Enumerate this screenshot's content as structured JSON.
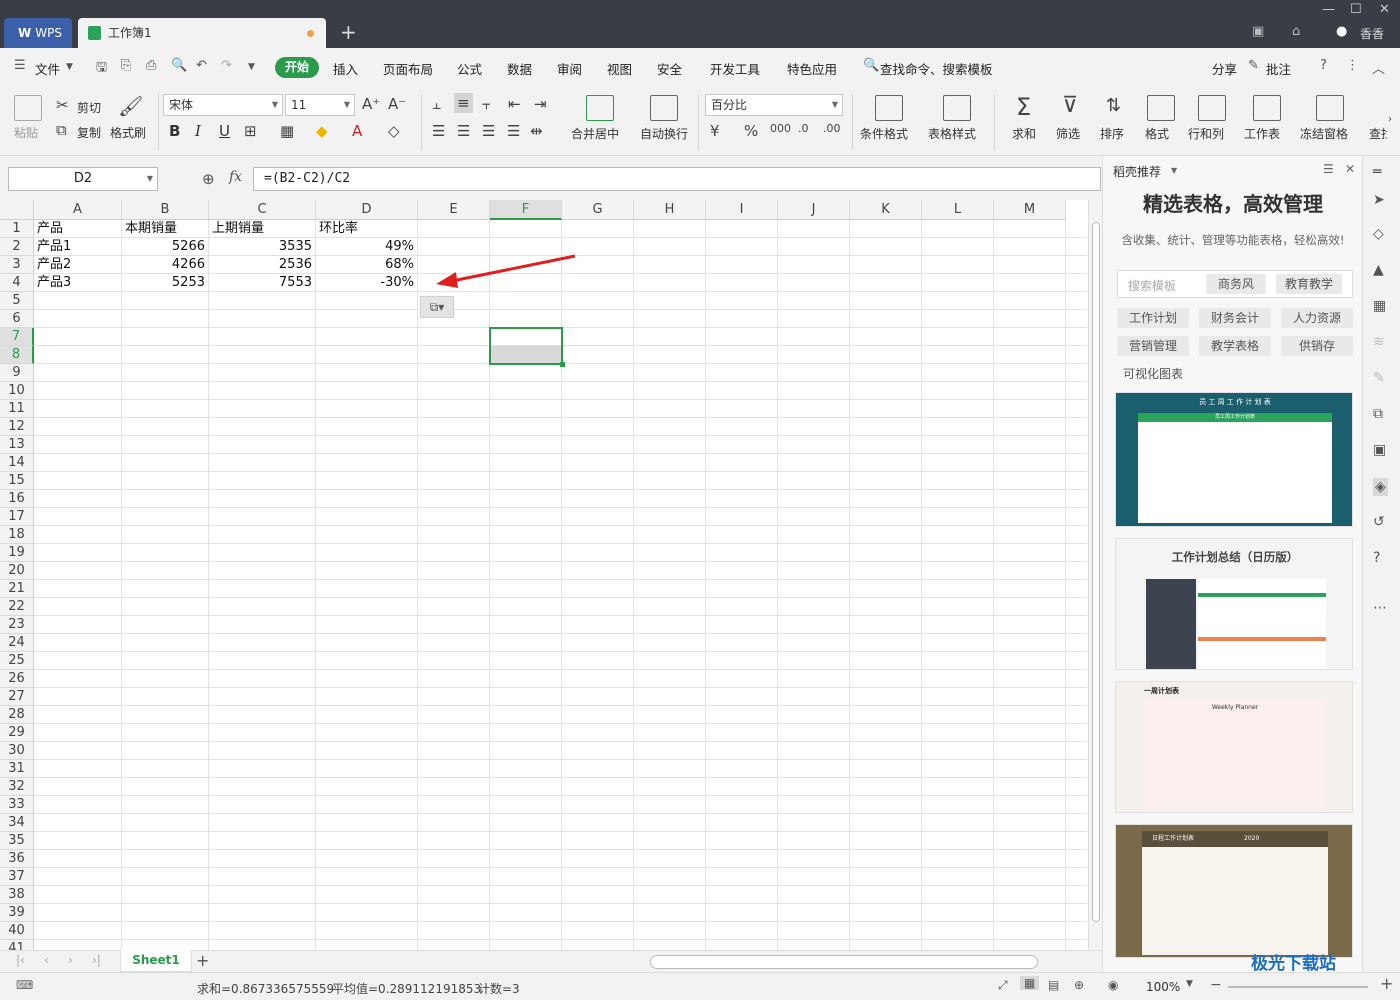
{
  "titlebar": {
    "wps_label": "WPS",
    "doc_tab": "工作簿1",
    "new_tab": "+",
    "user_name": "香香"
  },
  "menubar": {
    "file": "文件",
    "start": "开始",
    "items": [
      "插入",
      "页面布局",
      "公式",
      "数据",
      "审阅",
      "视图",
      "安全",
      "开发工具",
      "特色应用"
    ],
    "search": "查找命令、搜索模板",
    "share": "分享",
    "comment": "批注"
  },
  "ribbon": {
    "paste": "粘贴",
    "cut": "剪切",
    "copy": "复制",
    "format_painter": "格式刷",
    "font_name": "宋体",
    "font_size": "11",
    "bold": "B",
    "italic": "I",
    "underline": "U",
    "number_format": "百分比",
    "merge_center": "合并居中",
    "wrap_text": "自动换行",
    "cond_format": "条件格式",
    "table_style": "表格样式",
    "sum": "求和",
    "filter": "筛选",
    "sort": "排序",
    "format": "格式",
    "row_col": "行和列",
    "worksheet": "工作表",
    "freeze": "冻结窗格",
    "find": "查找"
  },
  "formula": {
    "cell_ref": "D2",
    "fx": "fx",
    "value": "=(B2-C2)/C2"
  },
  "sheet": {
    "columns": [
      "A",
      "B",
      "C",
      "D",
      "E",
      "F",
      "G",
      "H",
      "I",
      "J",
      "K",
      "L",
      "M"
    ],
    "rows": [
      "1",
      "2",
      "3",
      "4",
      "5",
      "6",
      "7",
      "8",
      "9",
      "10",
      "11",
      "12",
      "13",
      "14",
      "15",
      "16",
      "17",
      "18",
      "19",
      "20",
      "21",
      "22",
      "23",
      "24",
      "25",
      "26",
      "27",
      "28",
      "29",
      "30",
      "31",
      "32",
      "33",
      "34",
      "35",
      "36",
      "37",
      "38",
      "39",
      "40",
      "41"
    ],
    "headers": [
      "产品",
      "本期销量",
      "上期销量",
      "环比率"
    ],
    "data": [
      [
        "产品1",
        "5266",
        "3535",
        "49%"
      ],
      [
        "产品2",
        "4266",
        "2536",
        "68%"
      ],
      [
        "产品3",
        "5253",
        "7553",
        "-30%"
      ]
    ],
    "tab_name": "Sheet1"
  },
  "status": {
    "sum": "求和=0.867336575559",
    "avg": "平均值=0.289112191853",
    "count": "计数=3",
    "zoom": "100%"
  },
  "sidepanel": {
    "title": "稻壳推荐",
    "headline": "精选表格，高效管理",
    "subline": "含收集、统计、管理等功能表格，轻松高效!",
    "search_placeholder": "搜索模板",
    "search_tags": [
      "商务风",
      "教育教学"
    ],
    "categories": [
      "工作计划",
      "财务会计",
      "人力资源",
      "营销管理",
      "教学表格",
      "供销存",
      "可视化图表"
    ],
    "templates": [
      {
        "title": "员 工 周 工 作 计 划 表",
        "sub": "员工周工作计划表"
      },
      {
        "title": "工作计划总结（日历版）"
      },
      {
        "title": "一周计划表",
        "sub": "Weekly Planner"
      },
      {
        "title": "日程工作计划表",
        "sub": "2020"
      }
    ],
    "watermark": "极光下载站"
  },
  "colors": {
    "accent": "#2a9a4b",
    "titlebar": "#3a3d46",
    "arrow": "#e02020"
  }
}
